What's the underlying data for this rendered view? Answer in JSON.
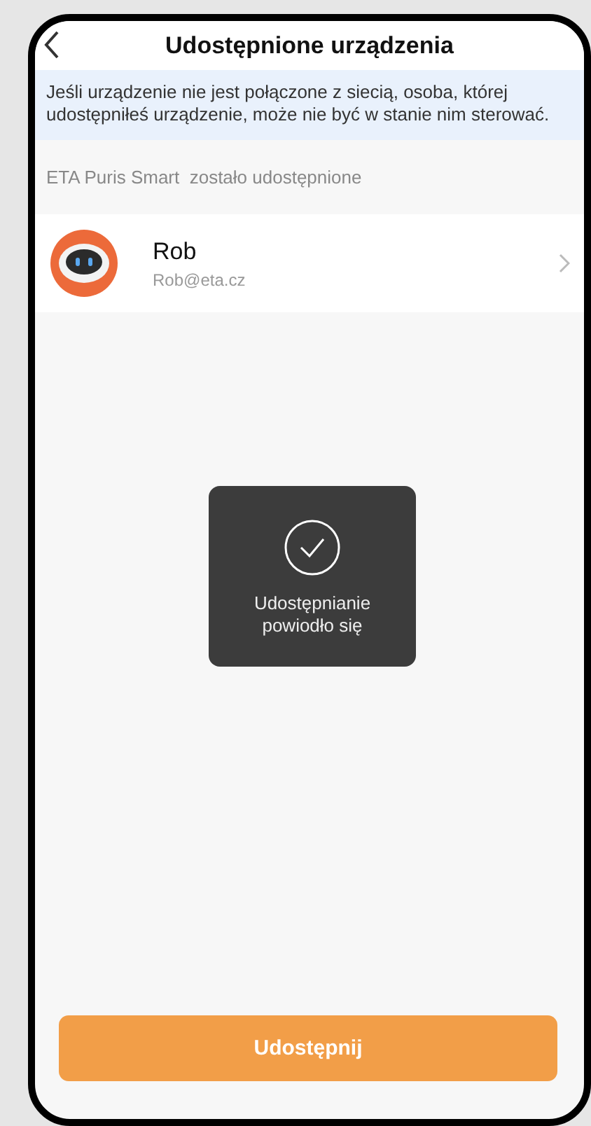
{
  "header": {
    "title": "Udostępnione urządzenia"
  },
  "notice": "Jeśli urządzenie nie jest połączone z siecią, osoba, której udostępniłeś urządzenie, może nie być w stanie nim sterować.",
  "section_label": "ETA Puris Smart  zostało udostępnione",
  "users": [
    {
      "name": "Rob",
      "email": "Rob@eta.cz"
    }
  ],
  "toast": {
    "message": "Udostępnianie powiodło się"
  },
  "share_button": "Udostępnij"
}
